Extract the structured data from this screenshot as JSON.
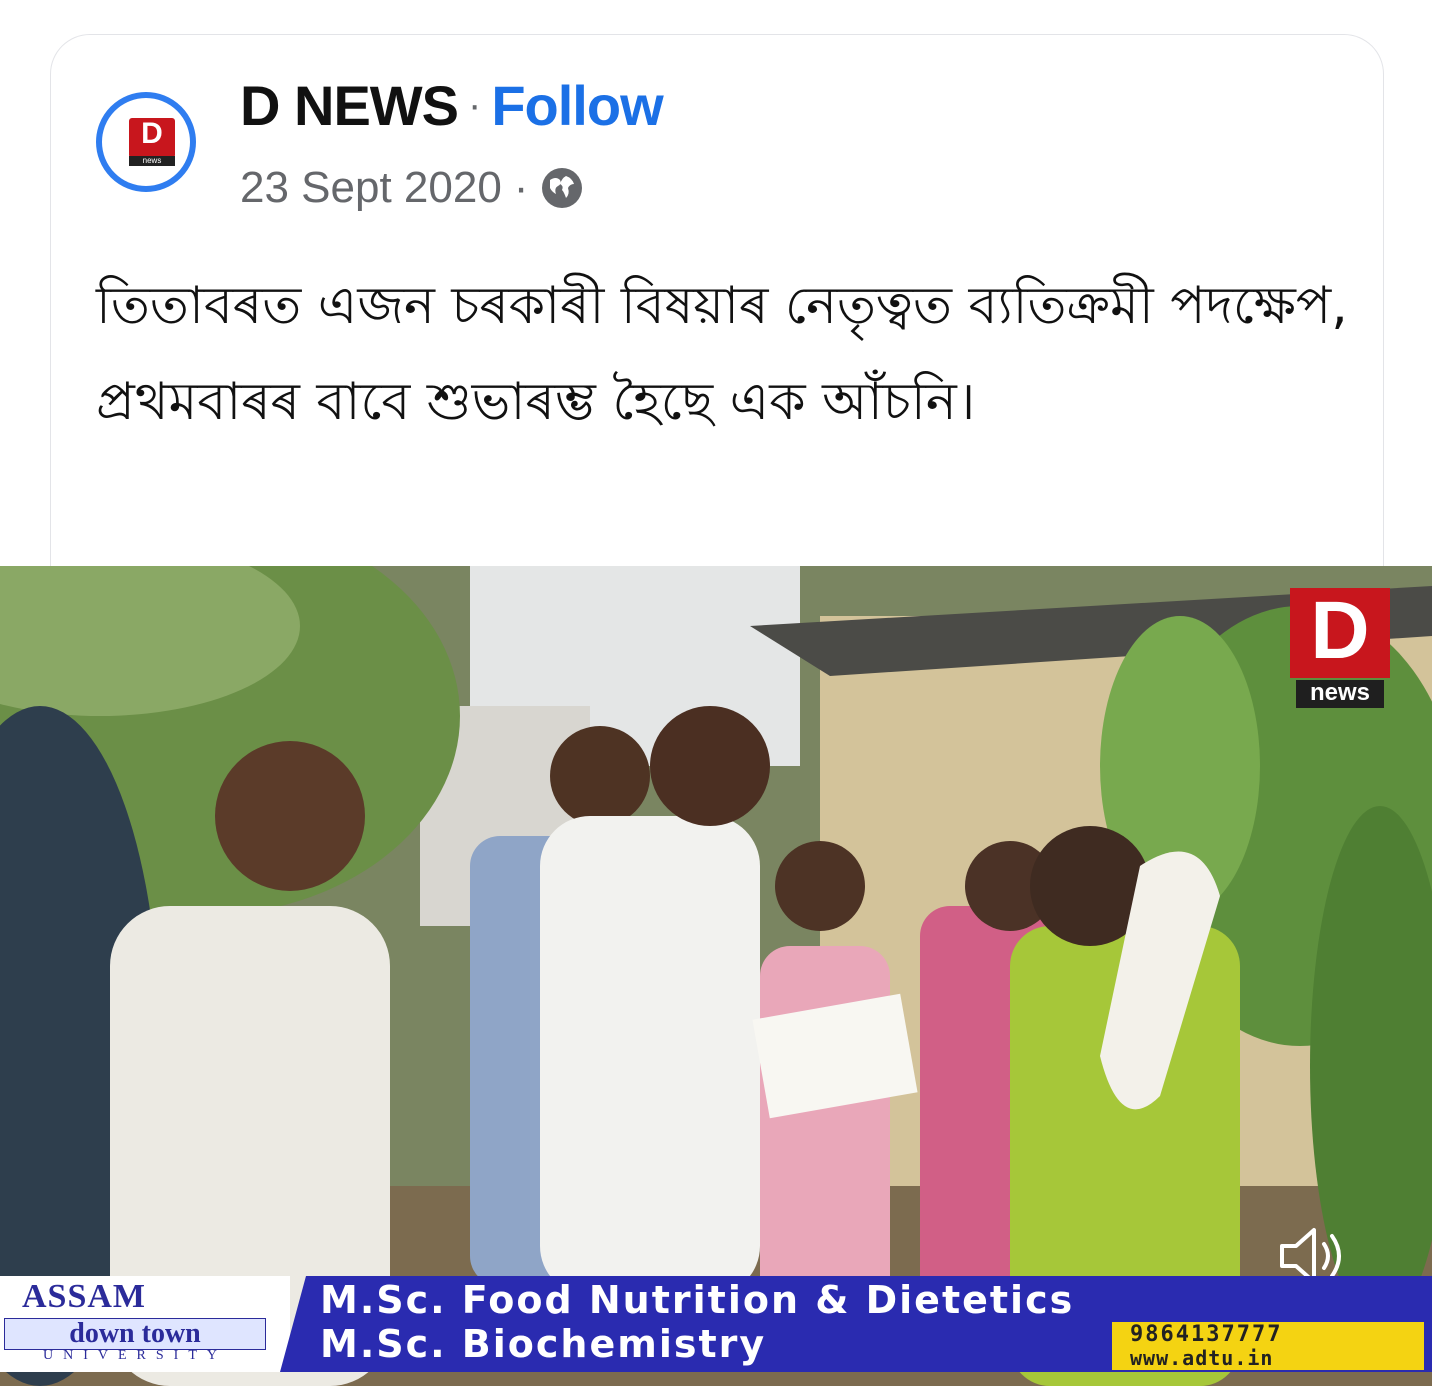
{
  "post": {
    "page_name": "D NEWS",
    "separator": "·",
    "follow_label": "Follow",
    "date": "23 Sept 2020",
    "date_separator": "·",
    "privacy_icon": "globe-icon",
    "text": "তিতাবৰত এজন চৰকাৰী বিষয়াৰ নেতৃত্বত ব্যতিক্রমী পদক্ষেপ, প্ৰথমবাৰৰ বাবে শুভাৰম্ভ হৈছে এক আঁচনি।",
    "avatar_logo": "D",
    "avatar_logo_sub": "news"
  },
  "media": {
    "watermark_logo": "D",
    "watermark_sub": "news",
    "sound_icon": "speaker-icon",
    "ticker": {
      "university_line1": "ASSAM",
      "university_line2": "down town",
      "university_line3": "UNIVERSITY",
      "line1": "M.Sc. Food Nutrition & Dietetics",
      "line2": "M.Sc. Biochemistry",
      "phone": "9864137777",
      "website": "www.adtu.in"
    }
  },
  "colors": {
    "follow": "#1b70e6",
    "avatar_ring": "#2f7df0",
    "logo_red": "#c8161d",
    "ticker_blue": "#2a2bb0",
    "contact_yellow": "#f4d312"
  }
}
